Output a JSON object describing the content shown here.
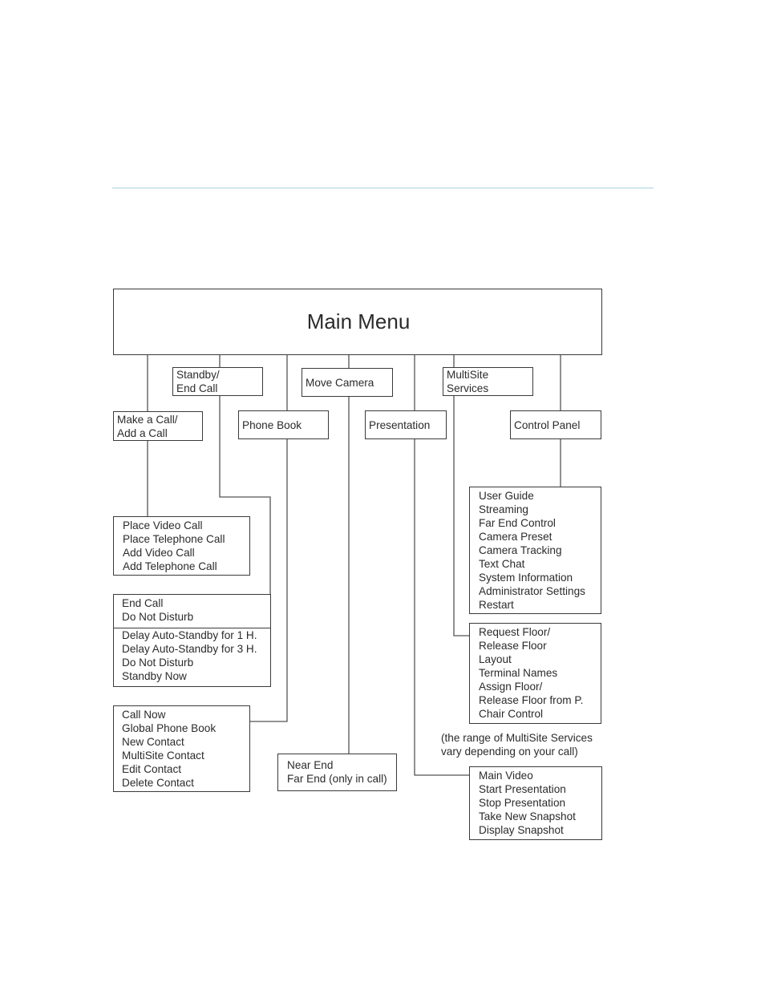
{
  "diagram": {
    "title": "Main Menu",
    "level1": [
      {
        "id": "make-call",
        "lines": [
          "Make a Call/",
          "Add a Call"
        ]
      },
      {
        "id": "standby",
        "lines": [
          "Standby/",
          "End Call"
        ]
      },
      {
        "id": "phone-book",
        "lines": [
          "Phone Book"
        ]
      },
      {
        "id": "move-camera",
        "lines": [
          "Move Camera"
        ]
      },
      {
        "id": "presentation",
        "lines": [
          "Presentation"
        ]
      },
      {
        "id": "multisite",
        "lines": [
          "MultiSite",
          "Services"
        ]
      },
      {
        "id": "control-panel",
        "lines": [
          "Control Panel"
        ]
      }
    ],
    "submenus": {
      "make_call": [
        "Place Video Call",
        "Place Telephone Call",
        "Add Video Call",
        "Add Telephone Call"
      ],
      "standby_in_call": [
        "End Call",
        "Do Not Disturb"
      ],
      "standby_idle": [
        "Delay Auto-Standby for 1 H.",
        "Delay Auto-Standby for 3 H.",
        "Do Not Disturb",
        "Standby Now"
      ],
      "phone_book": [
        "Call Now",
        "Global Phone Book",
        "New Contact",
        "MultiSite Contact",
        "Edit Contact",
        "Delete Contact"
      ],
      "move_camera": [
        "Near End",
        "Far End (only in call)"
      ],
      "control_panel": [
        "User Guide",
        "Streaming",
        "Far End Control",
        "Camera Preset",
        "Camera Tracking",
        "Text Chat",
        "System Information",
        "Administrator Settings",
        "Restart"
      ],
      "multisite": [
        "Request Floor/",
        "Release Floor",
        "Layout",
        "Terminal Names",
        "Assign Floor/",
        "Release Floor from P.",
        "Chair Control"
      ],
      "presentation": [
        "Main Video",
        "Start Presentation",
        "Stop Presentation",
        "Take New Snapshot",
        "Display Snapshot"
      ]
    },
    "note": [
      "(the range of MultiSite Services",
      "vary depending on your call)"
    ]
  }
}
